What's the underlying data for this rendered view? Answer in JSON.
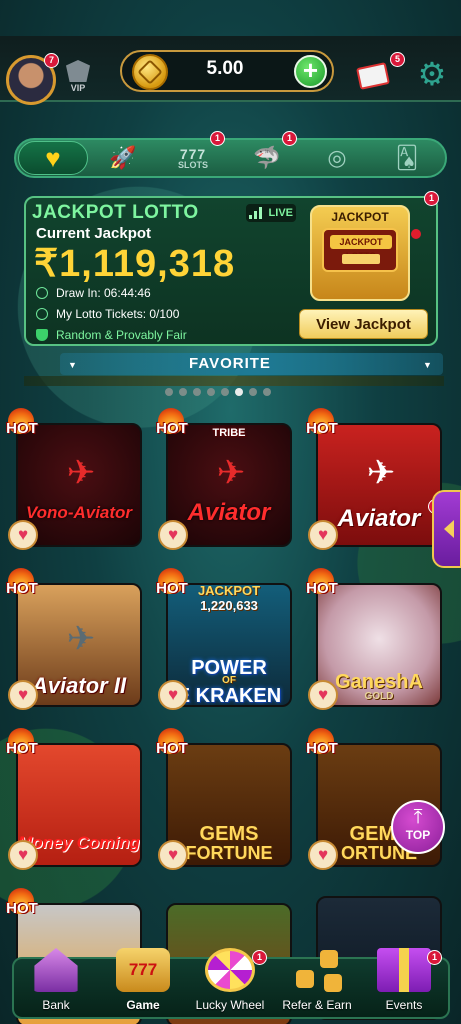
{
  "header": {
    "avatar_badge": "7",
    "vip_label": "VIP",
    "balance": "5.00",
    "mail_badge": "5"
  },
  "categories": [
    {
      "name": "favorite",
      "icon": "heart-icon",
      "active": true,
      "badge": ""
    },
    {
      "name": "crash",
      "icon": "rocket-icon",
      "active": false,
      "badge": ""
    },
    {
      "name": "slots",
      "icon": "slots-icon",
      "label_top": "777",
      "label": "SLOTS",
      "active": false,
      "badge": "1"
    },
    {
      "name": "fishing",
      "icon": "shark-icon",
      "active": false,
      "badge": "1"
    },
    {
      "name": "roulette",
      "icon": "roulette-icon",
      "active": false,
      "badge": ""
    },
    {
      "name": "cards",
      "icon": "cards-icon",
      "active": false,
      "badge": ""
    }
  ],
  "jackpot": {
    "title": "JACKPOT LOTTO",
    "live": "LIVE",
    "current_label": "Current Jackpot",
    "amount": "₹1,119,318",
    "draw_in": "Draw In: 06:44:46",
    "tickets": "My Lotto Tickets: 0/100",
    "fair": "Random & Provably Fair",
    "machine_label": "JACKPOT",
    "machine_screen": "JACKPOT LOTTO",
    "view_button": "View Jackpot",
    "badge": "1"
  },
  "favorite_banner": "FAVORITE",
  "carousel": {
    "count": 8,
    "active_index": 5
  },
  "hot_label": "HOT",
  "games": [
    {
      "name": "Vono-Aviator"
    },
    {
      "name": "Aviator",
      "top_text": "TRIBE"
    },
    {
      "name": "Aviator",
      "badge": "1"
    },
    {
      "name": "Aviator II"
    },
    {
      "name": "POWER OF THE KRAKEN",
      "line1": "POWER",
      "line2": "OF",
      "line3": "E KRAKEN",
      "jackpot_label": "JACKPOT",
      "jackpot_value": "1,220,633"
    },
    {
      "name": "Ganesha Gold",
      "line1": "GaneshA",
      "line2": "GOLD"
    },
    {
      "name": "Money Coming",
      "line1": "Money Coming"
    },
    {
      "name": "Gems Fortune",
      "line1": "GEMS",
      "line2": "FORTUNE"
    },
    {
      "name": "Gems Fortune",
      "line1": "GEMS",
      "line2": "ORTUNE"
    }
  ],
  "top_button": "TOP",
  "bottom_nav": [
    {
      "label": "Bank",
      "icon": "bank-icon",
      "active": false,
      "badge": ""
    },
    {
      "label": "Game",
      "icon": "game-icon",
      "icon_text": "777",
      "active": true,
      "badge": ""
    },
    {
      "label": "Lucky Wheel",
      "icon": "wheel-icon",
      "active": false,
      "badge": "1"
    },
    {
      "label": "Refer & Earn",
      "icon": "refer-icon",
      "active": false,
      "badge": ""
    },
    {
      "label": "Events",
      "icon": "gift-icon",
      "active": false,
      "badge": "1"
    }
  ],
  "colors": {
    "accent_green": "#7ef5a0",
    "jackpot_gold": "#ffd437",
    "badge_red": "#d9183a",
    "background": "#0f3f42"
  }
}
